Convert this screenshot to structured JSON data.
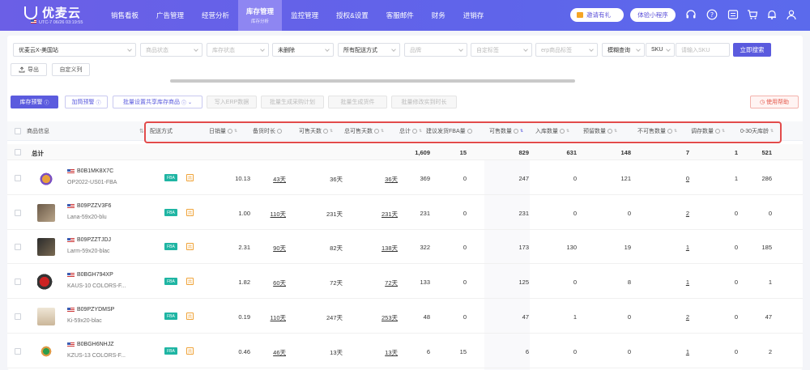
{
  "app": {
    "logo_text": "优麦云",
    "timezone": "UTC-7 06/26 03:19:55"
  },
  "nav": [
    {
      "label": "销售看板",
      "sub": ""
    },
    {
      "label": "广告管理",
      "sub": ""
    },
    {
      "label": "经营分析",
      "sub": ""
    },
    {
      "label": "库存管理",
      "sub": "库存分析"
    },
    {
      "label": "监控管理",
      "sub": ""
    },
    {
      "label": "授权&设置",
      "sub": ""
    },
    {
      "label": "客服邮件",
      "sub": ""
    },
    {
      "label": "财务",
      "sub": ""
    },
    {
      "label": "进销存",
      "sub": ""
    }
  ],
  "header_buttons": {
    "invite": "邀请有礼",
    "trial": "体验小程序"
  },
  "filters": {
    "shop": "优麦云X-美国站",
    "product_status": "商品状态",
    "stock_status": "库存状态",
    "deleted": "未删除",
    "fulfillment": "所有配送方式",
    "brand": "品牌",
    "custom_tag": "自定标签",
    "erp_tag": "erp商品标签",
    "match_mode": "模糊查询",
    "field": "SKU",
    "search_placeholder": "请输入SKU",
    "search_button": "立即搜索",
    "export": "导出",
    "custom_columns": "自定义列"
  },
  "toolbar": {
    "inventory_warning": "库存预警",
    "add_warning": "加筒预警",
    "batch_set_shared": "批量设置共享库存商品",
    "write_erp": "写入ERP数据",
    "batch_purchase_plan": "批量生成采购计划",
    "batch_shipment": "批量生成货件",
    "batch_mark_receive": "批量修改实到时长",
    "help": "使用帮助"
  },
  "table": {
    "headers": {
      "product_info": "商品信息",
      "fulfillment": "配送方式",
      "daily_sales": "日销量",
      "stock_duration": "备货时长",
      "sellable_days": "可售天数",
      "total_sellable_days": "总可售天数",
      "total": "总计",
      "suggested_fba": "建议发货FBA量",
      "sellable_qty": "可售数量",
      "inbound_qty": "入库数量",
      "reserved_qty": "预留数量",
      "unsellable_qty": "不可售数量",
      "in_transit": "调存数量",
      "age_0_30": "0-30天库龄"
    },
    "total_row": {
      "label": "总计",
      "total": "1,609",
      "suggested_fba": "15",
      "sellable_qty": "829",
      "inbound_qty": "631",
      "reserved_qty": "148",
      "unsellable_qty": "7",
      "in_transit": "1",
      "age_0_30": "521"
    },
    "rows": [
      {
        "asin": "B0B1MK8X7C",
        "sku": "OP2022-US01-FBA",
        "fba": "FBA",
        "shared": "共",
        "daily_sales": "10.13",
        "stock_duration": "43天",
        "sellable_days": "36天",
        "total_sellable_days": "36天",
        "total": "369",
        "suggested_fba": "0",
        "sellable_qty": "247",
        "inbound_qty": "0",
        "reserved_qty": "121",
        "unsellable_qty": "0",
        "in_transit": "1",
        "age_0_30": "286"
      },
      {
        "asin": "B09PZZV3F6",
        "sku": "Lana-59x20-blu",
        "fba": "FBA",
        "shared": "共",
        "daily_sales": "1.00",
        "stock_duration": "110天",
        "sellable_days": "231天",
        "total_sellable_days": "231天",
        "total": "231",
        "suggested_fba": "0",
        "sellable_qty": "231",
        "inbound_qty": "0",
        "reserved_qty": "0",
        "unsellable_qty": "2",
        "in_transit": "0",
        "age_0_30": "0"
      },
      {
        "asin": "B09PZZTJDJ",
        "sku": "Larm-59x20-blac",
        "fba": "FBA",
        "shared": "共",
        "daily_sales": "2.31",
        "stock_duration": "90天",
        "sellable_days": "82天",
        "total_sellable_days": "138天",
        "total": "322",
        "suggested_fba": "0",
        "sellable_qty": "173",
        "inbound_qty": "130",
        "reserved_qty": "19",
        "unsellable_qty": "1",
        "in_transit": "0",
        "age_0_30": "185"
      },
      {
        "asin": "B0BGH794XP",
        "sku": "KAUS-10 COLORS-F...",
        "fba": "FBA",
        "shared": "共",
        "daily_sales": "1.82",
        "stock_duration": "60天",
        "sellable_days": "72天",
        "total_sellable_days": "72天",
        "total": "133",
        "suggested_fba": "0",
        "sellable_qty": "125",
        "inbound_qty": "0",
        "reserved_qty": "8",
        "unsellable_qty": "1",
        "in_transit": "0",
        "age_0_30": "1"
      },
      {
        "asin": "B09PZYDMSP",
        "sku": "Ki-59x20-blac",
        "fba": "FBA",
        "shared": "共",
        "daily_sales": "0.19",
        "stock_duration": "110天",
        "sellable_days": "247天",
        "total_sellable_days": "253天",
        "total": "48",
        "suggested_fba": "0",
        "sellable_qty": "47",
        "inbound_qty": "1",
        "reserved_qty": "0",
        "unsellable_qty": "2",
        "in_transit": "0",
        "age_0_30": "47"
      },
      {
        "asin": "B0BGH6NHJZ",
        "sku": "KZUS-13 COLORS-F...",
        "fba": "FBA",
        "shared": "共",
        "daily_sales": "0.46",
        "stock_duration": "46天",
        "sellable_days": "13天",
        "total_sellable_days": "13天",
        "total": "6",
        "suggested_fba": "15",
        "sellable_qty": "6",
        "inbound_qty": "0",
        "reserved_qty": "0",
        "unsellable_qty": "1",
        "in_transit": "0",
        "age_0_30": "2"
      }
    ]
  },
  "colors": {
    "brand": "#5f64ea",
    "primary_button": "#5b5bde",
    "highlight_border": "#e24b4b",
    "fba_tag": "#1fb5a3",
    "shared_tag": "#f0a43a"
  }
}
